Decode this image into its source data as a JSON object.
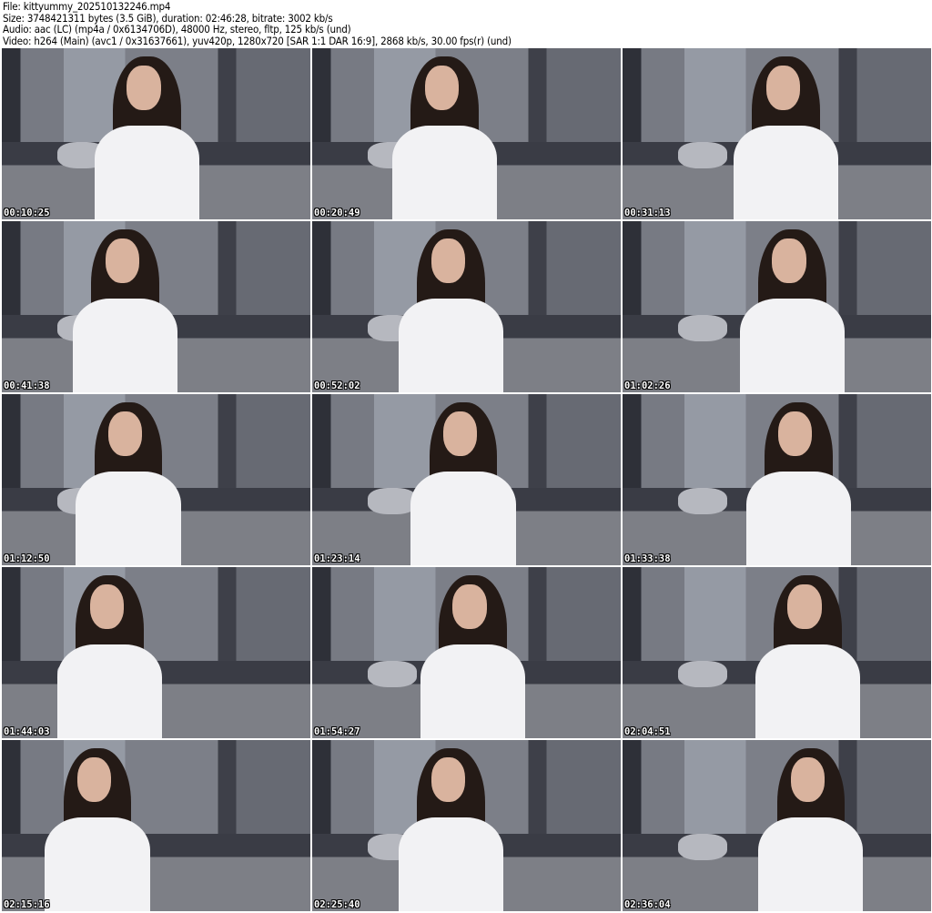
{
  "header": {
    "file": "File: kittyummy_202510132246.mp4",
    "size": "Size: 3748421311 bytes (3.5 GiB), duration: 02:46:28, bitrate: 3002 kb/s",
    "audio": "Audio: aac (LC) (mp4a / 0x6134706D), 48000 Hz, stereo, fltp, 125 kb/s (und)",
    "video": "Video: h264 (Main) (avc1 / 0x31637661), yuv420p, 1280x720 [SAR 1:1 DAR 16:9], 2868 kb/s, 30.00 fps(r) (und)"
  },
  "thumbnails": [
    {
      "timestamp": "00:10:25"
    },
    {
      "timestamp": "00:20:49"
    },
    {
      "timestamp": "00:31:13"
    },
    {
      "timestamp": "00:41:38"
    },
    {
      "timestamp": "00:52:02"
    },
    {
      "timestamp": "01:02:26"
    },
    {
      "timestamp": "01:12:50"
    },
    {
      "timestamp": "01:23:14"
    },
    {
      "timestamp": "01:33:38"
    },
    {
      "timestamp": "01:44:03"
    },
    {
      "timestamp": "01:54:27"
    },
    {
      "timestamp": "02:04:51"
    },
    {
      "timestamp": "02:15:16"
    },
    {
      "timestamp": "02:25:40"
    },
    {
      "timestamp": "02:36:04"
    }
  ]
}
